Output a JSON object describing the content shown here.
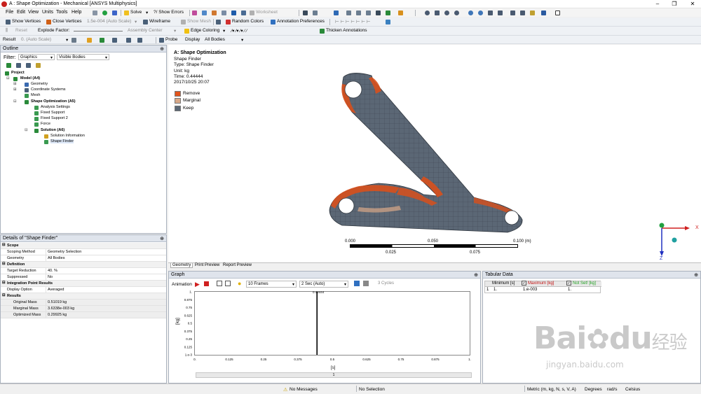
{
  "window": {
    "title": "A : Shape Optimization - Mechanical [ANSYS Multiphysics]",
    "min": "–",
    "max": "❐",
    "close": "✕"
  },
  "menu": [
    "File",
    "Edit",
    "View",
    "Units",
    "Tools",
    "Help"
  ],
  "toolbar1": {
    "solve": "Solve",
    "show_errors": "?/ Show Errors",
    "worksheet": "Worksheet"
  },
  "toolbar2": {
    "show_vertices": "Show Vertices",
    "close_vertices": "Close Vertices",
    "scale": "1.5e-004 (Auto Scale)",
    "wireframe": "Wireframe",
    "show_mesh": "Show Mesh",
    "random_colors": "Random Colors",
    "annotation_prefs": "Annotation Preferences"
  },
  "toolbar3": {
    "reset": "Reset",
    "explode_factor": "Explode Factor:",
    "assembly_center": "Assembly Center",
    "edge_coloring": "Edge Coloring",
    "thicken": "Thicken Annotations"
  },
  "toolbar4": {
    "result": "Result",
    "result_value": "0. (Auto Scale)",
    "probe": "Probe",
    "display": "Display",
    "display_value": "All Bodies"
  },
  "outline": {
    "title": "Outline",
    "pin": "⊕",
    "filter_label": "Filter:",
    "filter_value": "Graphics",
    "filter2": "Visible Bodies",
    "items": [
      {
        "label": "Project",
        "bold": true
      },
      {
        "label": "Model (A4)",
        "bold": true
      },
      {
        "label": "Geometry",
        "bold": false
      },
      {
        "label": "Coordinate Systems",
        "bold": false
      },
      {
        "label": "Mesh",
        "bold": false
      },
      {
        "label": "Shape Optimization (A5)",
        "bold": true
      },
      {
        "label": "Analysis Settings",
        "bold": false
      },
      {
        "label": "Fixed Support",
        "bold": false
      },
      {
        "label": "Fixed Support 2",
        "bold": false
      },
      {
        "label": "Force",
        "bold": false
      },
      {
        "label": "Solution (A6)",
        "bold": true
      },
      {
        "label": "Solution Information",
        "bold": false
      },
      {
        "label": "Shape Finder",
        "bold": false
      }
    ]
  },
  "details": {
    "title": "Details of \"Shape Finder\"",
    "pin": "⊕",
    "rows": [
      {
        "type": "sec",
        "k": "Scope"
      },
      {
        "type": "row",
        "k": "Scoping Method",
        "v": "Geometry Selection"
      },
      {
        "type": "row",
        "k": "Geometry",
        "v": "All Bodies"
      },
      {
        "type": "sec",
        "k": "Definition"
      },
      {
        "type": "row",
        "k": "Target Reduction",
        "v": "40. %"
      },
      {
        "type": "row",
        "k": "Suppressed",
        "v": "No"
      },
      {
        "type": "sec",
        "k": "Integration Point Results"
      },
      {
        "type": "row",
        "k": "Display Option",
        "v": "Averaged"
      },
      {
        "type": "sec",
        "k": "Results"
      },
      {
        "type": "row",
        "k": "Original Mass",
        "v": "0.51019 kg"
      },
      {
        "type": "row",
        "k": "Marginal Mass",
        "v": "3.6338e-003 kg"
      },
      {
        "type": "row",
        "k": "Optimized Mass",
        "v": "0.29925 kg"
      }
    ]
  },
  "viewport": {
    "title": "A: Shape Optimization",
    "lines": [
      "Shape Finder",
      "Type: Shape Finder",
      "Unit: kg",
      "Time: 0.44444",
      "2017/10/25 20:07"
    ],
    "legend": [
      {
        "label": "Remove",
        "color": "#e2541c"
      },
      {
        "label": "Marginal",
        "color": "#d8a888"
      },
      {
        "label": "Keep",
        "color": "#5b6775"
      }
    ],
    "scale_labels": [
      "0.000",
      "0.050",
      "0.100 (m)"
    ],
    "scale_sub": [
      "0.025",
      "0.075"
    ],
    "axis_x": "X",
    "axis_z": "Z",
    "tabs": [
      "Geometry",
      "Print Preview",
      "Report Preview"
    ]
  },
  "graph": {
    "title": "Graph",
    "pin": "⊕",
    "animation": "Animation",
    "frames": "10 Frames",
    "speed": "2 Sec (Auto)",
    "cycles": "3 Cycles",
    "marker_label": "0.44444",
    "xlabel": "[s]",
    "ylabel": "[kg]",
    "footer": "1"
  },
  "chart_data": {
    "type": "line",
    "title": "",
    "xlabel": "[s]",
    "ylabel": "[kg]",
    "xlim": [
      0,
      1
    ],
    "ylim": [
      0.001,
      1
    ],
    "x_ticks": [
      "0.",
      "0.125",
      "0.25",
      "0.375",
      "0.5",
      "0.625",
      "0.75",
      "0.875",
      "1."
    ],
    "y_ticks": [
      "1.",
      "0.875",
      "0.75",
      "0.625",
      "0.5",
      "0.375",
      "0.25",
      "0.125",
      "1.e-3"
    ],
    "series": [
      {
        "values": [
          [
            0.44444,
            0.001
          ],
          [
            0.44444,
            1
          ]
        ]
      }
    ]
  },
  "tabular": {
    "title": "Tabular Data",
    "pin": "⊕",
    "headers": [
      "Minimum [s]",
      "Maximum [kg]",
      "Not Set! [kg]"
    ],
    "row_num": "1",
    "row": [
      "1.",
      "1.e-003",
      "1."
    ]
  },
  "status": {
    "messages": "No Messages",
    "selection": "No Selection",
    "units": "Metric (m, kg, N, s, V, A)",
    "deg": "Degrees",
    "rad": "rad/s",
    "temp": "Celsius"
  },
  "watermark": {
    "brand": "Bai",
    "paw": "du",
    "cn": "经验",
    "url": "jingyan.baidu.com"
  }
}
